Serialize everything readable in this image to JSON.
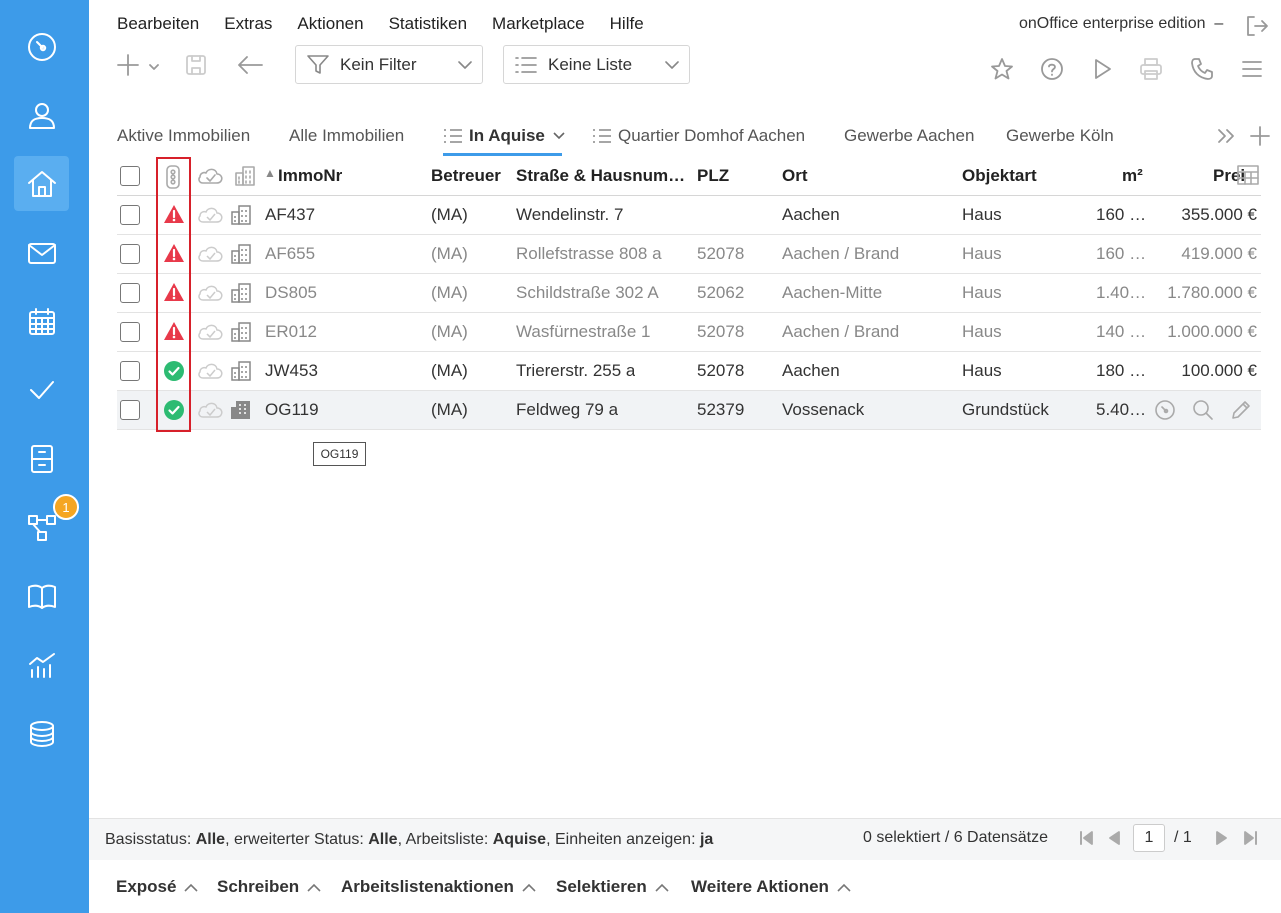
{
  "menu": [
    "Bearbeiten",
    "Extras",
    "Aktionen",
    "Statistiken",
    "Marketplace",
    "Hilfe"
  ],
  "edition": "onOffice enterprise edition",
  "edition_suffix": "–",
  "filter": {
    "label": "Kein Filter"
  },
  "list": {
    "label": "Keine Liste"
  },
  "tabs": [
    "Aktive Immobilien",
    "Alle Immobilien",
    "In Aquise",
    "Quartier Domhof Aachen",
    "Gewerbe Aachen",
    "Gewerbe Köln"
  ],
  "active_tab": "In Aquise",
  "sidebar_badge": "1",
  "columns": {
    "immonr": "ImmoNr",
    "betreuer": "Betreuer",
    "strasse": "Straße & Hausnum…",
    "plz": "PLZ",
    "ort": "Ort",
    "objektart": "Objektart",
    "m2": "m²",
    "preis": "Preis"
  },
  "rows": [
    {
      "status": "warning",
      "immonr": "AF437",
      "betreuer": "(MA)",
      "strasse": "Wendelinstr. 7",
      "plz": "",
      "ort": "Aachen",
      "objektart": "Haus",
      "m2": "160 …",
      "preis": "355.000 €",
      "dim": false
    },
    {
      "status": "warning",
      "immonr": "AF655",
      "betreuer": "(MA)",
      "strasse": "Rollefstrasse 808 a",
      "plz": "52078",
      "ort": "Aachen / Brand",
      "objektart": "Haus",
      "m2": "160 …",
      "preis": "419.000 €",
      "dim": true
    },
    {
      "status": "warning",
      "immonr": "DS805",
      "betreuer": "(MA)",
      "strasse": "Schildstraße 302 A",
      "plz": "52062",
      "ort": "Aachen-Mitte",
      "objektart": "Haus",
      "m2": "1.40…",
      "preis": "1.780.000 €",
      "dim": true
    },
    {
      "status": "warning",
      "immonr": "ER012",
      "betreuer": "(MA)",
      "strasse": "Wasfürnestraße 1",
      "plz": "52078",
      "ort": "Aachen / Brand",
      "objektart": "Haus",
      "m2": "140 …",
      "preis": "1.000.000 €",
      "dim": true
    },
    {
      "status": "ok",
      "immonr": "JW453",
      "betreuer": "(MA)",
      "strasse": "Triererstr. 255 a",
      "plz": "52078",
      "ort": "Aachen",
      "objektart": "Haus",
      "m2": "180 …",
      "preis": "100.000 €",
      "dim": false
    },
    {
      "status": "ok",
      "immonr": "OG119",
      "betreuer": "(MA)",
      "strasse": "Feldweg 79 a",
      "plz": "52379",
      "ort": "Vossenack",
      "objektart": "Grundstück",
      "m2": "5.40…",
      "preis": "",
      "dim": false
    }
  ],
  "tooltip": "OG119",
  "status": {
    "basis_label": "Basisstatus:",
    "basis_value": "Alle",
    "erw_label": ", erweiterter Status:",
    "erw_value": "Alle",
    "arb_label": ", Arbeitsliste:",
    "arb_value": "Aquise",
    "einh_label": ", Einheiten anzeigen:",
    "einh_value": "ja",
    "count": "0 selektiert / 6 Datensätze",
    "page": "1",
    "page_total": "/ 1"
  },
  "bottom_actions": [
    "Exposé",
    "Schreiben",
    "Arbeitslistenaktionen",
    "Selektieren",
    "Weitere Aktionen"
  ],
  "colors": {
    "sidebar": "#3d9be9",
    "warning": "#e8394a",
    "ok": "#2dbb72",
    "accent": "#3d9be9",
    "highlight_box": "#d7202a"
  }
}
